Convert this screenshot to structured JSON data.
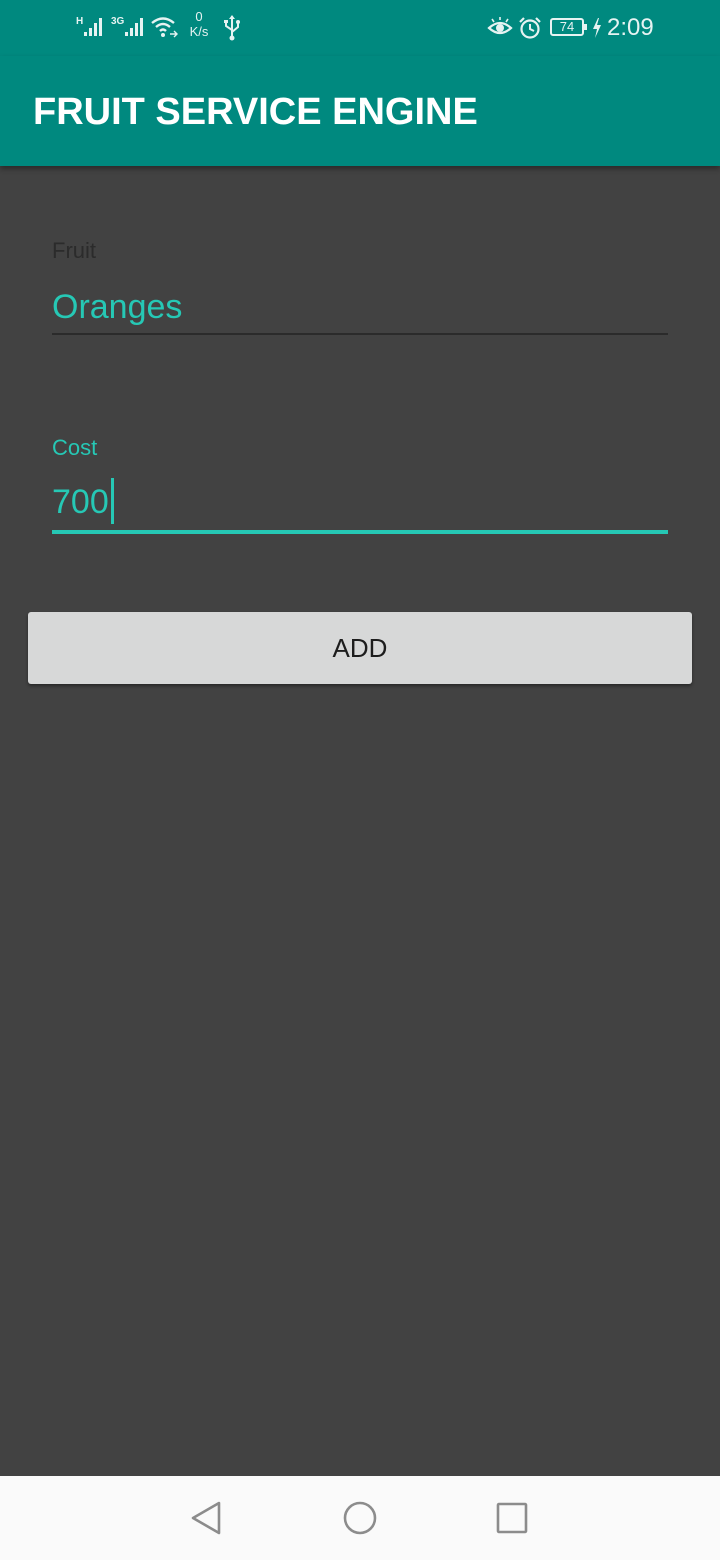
{
  "status_bar": {
    "signal_1_label": "H",
    "signal_2_label": "3G",
    "net_speed_value": "0",
    "net_speed_unit": "K/s",
    "battery_level": "74",
    "time": "2:09",
    "icons": [
      "signal-h-icon",
      "signal-3g-icon",
      "wifi-icon",
      "usb-icon",
      "eye-comfort-icon",
      "alarm-icon",
      "battery-icon",
      "charging-icon"
    ]
  },
  "toolbar": {
    "title": "FRUIT SERVICE ENGINE"
  },
  "form": {
    "fruit": {
      "label": "Fruit",
      "value": "Oranges"
    },
    "cost": {
      "label": "Cost",
      "value": "700"
    },
    "add_label": "ADD"
  },
  "nav_bar": {
    "icons": [
      "back-icon",
      "home-icon",
      "recents-icon"
    ]
  },
  "colors": {
    "primary": "#00897f",
    "accent": "#26c8b5",
    "background": "#424242",
    "button": "#d7d8d8"
  }
}
